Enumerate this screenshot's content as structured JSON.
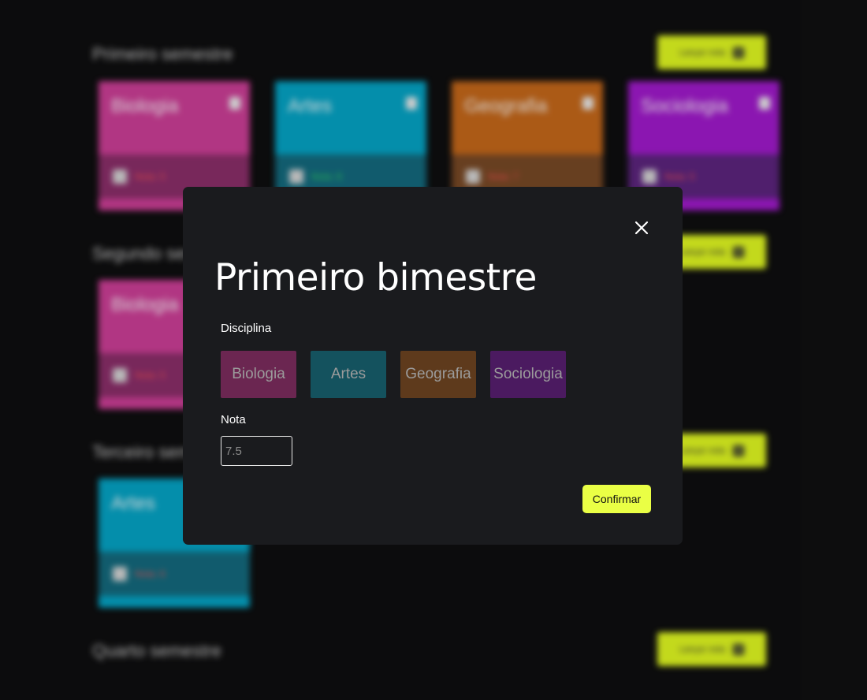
{
  "background": {
    "semesters": [
      {
        "title": "Primeiro semestre",
        "button_label": "Lançar nota"
      },
      {
        "title": "Segundo semestre",
        "button_label": "Lançar nota"
      },
      {
        "title": "Terceiro semestre",
        "button_label": "Lançar nota"
      },
      {
        "title": "Quarto semestre",
        "button_label": "Lançar nota"
      }
    ],
    "cards": [
      {
        "name": "Biologia",
        "date": "",
        "nota": "Nota: 5",
        "color": "#d1409a",
        "bottom": "#8e2f6c",
        "nota_color": "#ff5555"
      },
      {
        "name": "Artes",
        "date": "",
        "nota": "Nota: 8",
        "color": "#05a7c9",
        "bottom": "#146c80",
        "nota_color": "#33dd66"
      },
      {
        "name": "Geografia",
        "date": "",
        "nota": "Nota: 7",
        "color": "#c96a1b",
        "bottom": "#7a4a26",
        "nota_color": "#ff5555"
      },
      {
        "name": "Sociologia",
        "date": "",
        "nota": "Nota: 5",
        "color": "#a41bd0",
        "bottom": "#5e2580",
        "nota_color": "#ff5555"
      },
      {
        "name": "Biologia",
        "date": "",
        "nota": "Nota: 5",
        "color": "#d1409a",
        "bottom": "#8e2f6c",
        "nota_color": "#ff5555"
      },
      {
        "name": "Artes",
        "date": "",
        "nota": "Nota: 6",
        "color": "#05a7c9",
        "bottom": "#146c80",
        "nota_color": "#ff5555"
      }
    ],
    "accent": "#e6ff22"
  },
  "modal": {
    "title": "Primeiro bimestre",
    "discipline_label": "Disciplina",
    "options": [
      {
        "label": "Biologia",
        "color": "#6b2651"
      },
      {
        "label": "Artes",
        "color": "#14525e"
      },
      {
        "label": "Geografia",
        "color": "#5e3a1c"
      },
      {
        "label": "Sociologia",
        "color": "#4b1a60"
      }
    ],
    "nota_label": "Nota",
    "nota_placeholder": "7.5",
    "confirm_label": "Confirmar",
    "confirm_color": "#eaff45"
  }
}
